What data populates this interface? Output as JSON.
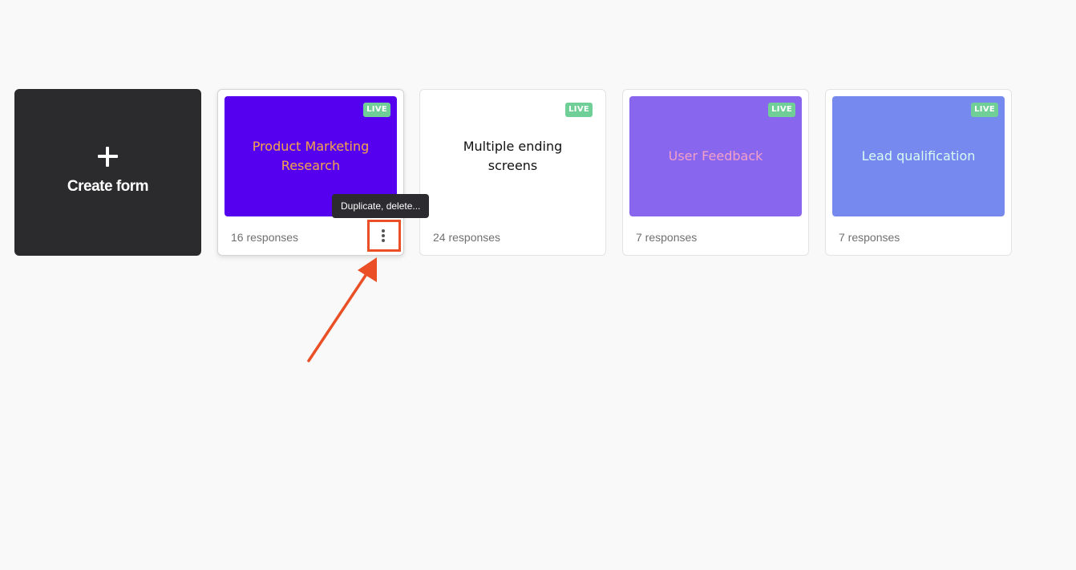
{
  "create_card": {
    "label": "Create form",
    "icon": "plus-icon"
  },
  "forms": [
    {
      "title": "Product Marketing Research",
      "status": "LIVE",
      "responses": "16 responses",
      "thumb_bg": "#5500ee",
      "title_color": "#f5a54a",
      "more_icon": "vertical-ellipsis-icon"
    },
    {
      "title": "Multiple ending screens",
      "status": "LIVE",
      "responses": "24 responses",
      "thumb_bg": "#ffffff",
      "title_color": "#111111"
    },
    {
      "title": "User Feedback",
      "status": "LIVE",
      "responses": "7 responses",
      "thumb_bg": "#8966ee",
      "title_color": "#f2a0c8"
    },
    {
      "title": "Lead qualification",
      "status": "LIVE",
      "responses": "7 responses",
      "thumb_bg": "#7689ef",
      "title_color": "#d9fbf2"
    }
  ],
  "tooltip": {
    "text": "Duplicate, delete..."
  },
  "colors": {
    "page_bg": "#f9f9f9",
    "create_card_bg": "#2b2b2d",
    "live_badge": "#6fcf97",
    "annotation": "#ea4f25"
  }
}
